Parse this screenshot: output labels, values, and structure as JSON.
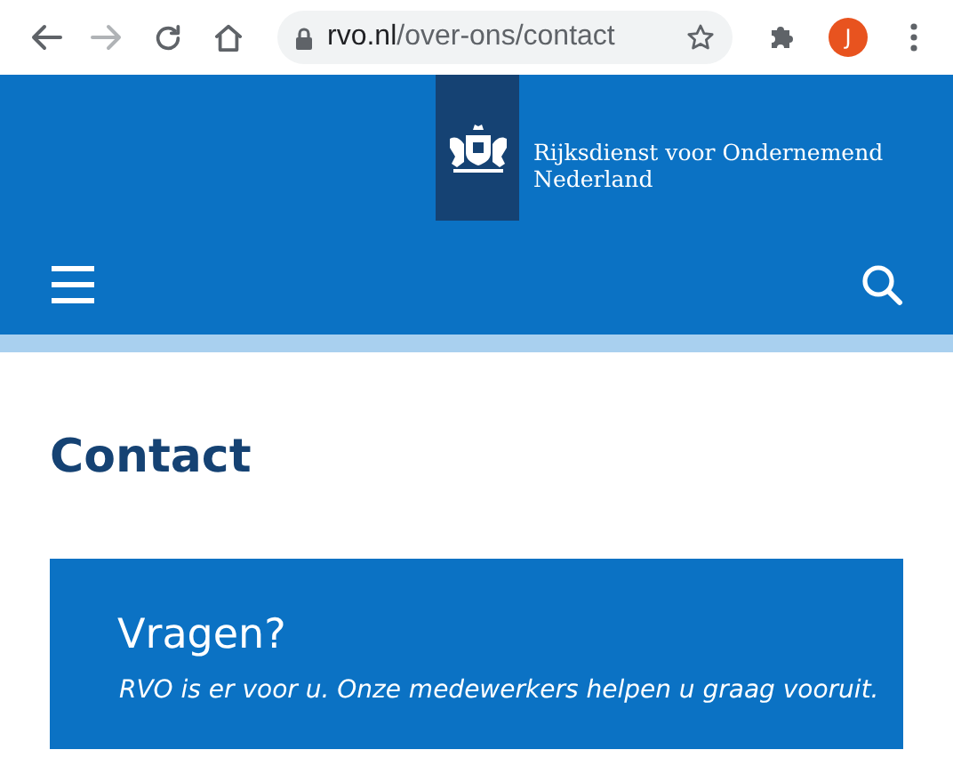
{
  "browser": {
    "url_host": "rvo.nl",
    "url_path": "/over-ons/contact",
    "profile_initial": "J"
  },
  "header": {
    "org_name": "Rijksdienst voor Ondernemend\nNederland"
  },
  "page": {
    "title": "Contact",
    "callout": {
      "heading": "Vragen?",
      "text": "RVO is er voor u. Onze medewerkers helpen u graag vooruit."
    }
  }
}
